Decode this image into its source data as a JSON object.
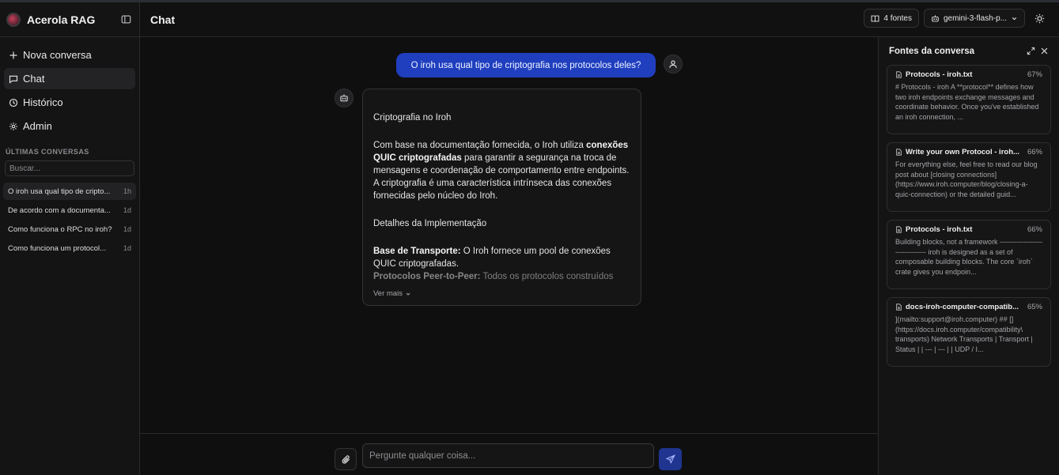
{
  "app": {
    "title": "Acerola RAG"
  },
  "sidebar": {
    "nav": [
      {
        "label": "Nova conversa",
        "icon": "plus-icon"
      },
      {
        "label": "Chat",
        "icon": "message-icon"
      },
      {
        "label": "Histórico",
        "icon": "history-icon"
      },
      {
        "label": "Admin",
        "icon": "gear-icon"
      }
    ],
    "section_title": "ÚLTIMAS CONVERSAS",
    "search_placeholder": "Buscar...",
    "conversations": [
      {
        "title": "O iroh usa qual tipo de cripto...",
        "time": "1h"
      },
      {
        "title": "De acordo com a documenta...",
        "time": "1d"
      },
      {
        "title": "Como funciona o RPC no iroh?",
        "time": "1d"
      },
      {
        "title": "Como funciona um protocol...",
        "time": "1d"
      }
    ]
  },
  "header": {
    "title": "Chat",
    "sources_button": "4 fontes",
    "model_button": "gemini-3-flash-p..."
  },
  "chat": {
    "user_message": "O iroh usa qual tipo de criptografia nos protocolos deles?",
    "assistant": {
      "heading": "Criptografia no Iroh",
      "para1_pre": "Com base na documentação fornecida, o Iroh utiliza ",
      "para1_bold": "conexões QUIC criptografadas",
      "para1_post": " para garantir a segurança na troca de mensagens e coordenação de comportamento entre endpoints. A criptografia é uma característica intrínseca das conexões fornecidas pelo núcleo do Iroh.",
      "heading2": "Detalhes da Implementação",
      "item1_bold": "Base de Transporte:",
      "item1_text": " O Iroh fornece um pool de conexões QUIC criptografadas.",
      "item2_bold": "Protocolos Peer-to-Peer:",
      "item2_text": " Todos os protocolos construídos",
      "see_more": "Ver mais"
    }
  },
  "composer": {
    "placeholder": "Pergunte qualquer coisa..."
  },
  "sources_panel": {
    "title": "Fontes da conversa",
    "items": [
      {
        "name": "Protocols - iroh.txt",
        "score": "67%",
        "excerpt": "# Protocols - iroh A **protocol** defines how two iroh endpoints exchange messages and coordinate behavior. Once you've established an iroh connection, ..."
      },
      {
        "name": "Write your own Protocol - iroh...",
        "score": "66%",
        "excerpt": "For everything else, feel free to read our blog post about [closing connections](https://www.iroh.computer/blog/closing-a-quic-connection) or the detailed guid..."
      },
      {
        "name": "Protocols - iroh.txt",
        "score": "66%",
        "excerpt": "Building blocks, not a framework ------------------------------- iroh is designed as a set of composable building blocks. The core `iroh` crate gives you endpoin..."
      },
      {
        "name": "docs-iroh-computer-compatib...",
        "score": "65%",
        "excerpt": "](mailto:support@iroh.computer) ## [](https://docs.iroh.computer/compatibility\\ transports) Network Transports | Transport | Status | | --- | --- | | UDP / I..."
      }
    ]
  }
}
